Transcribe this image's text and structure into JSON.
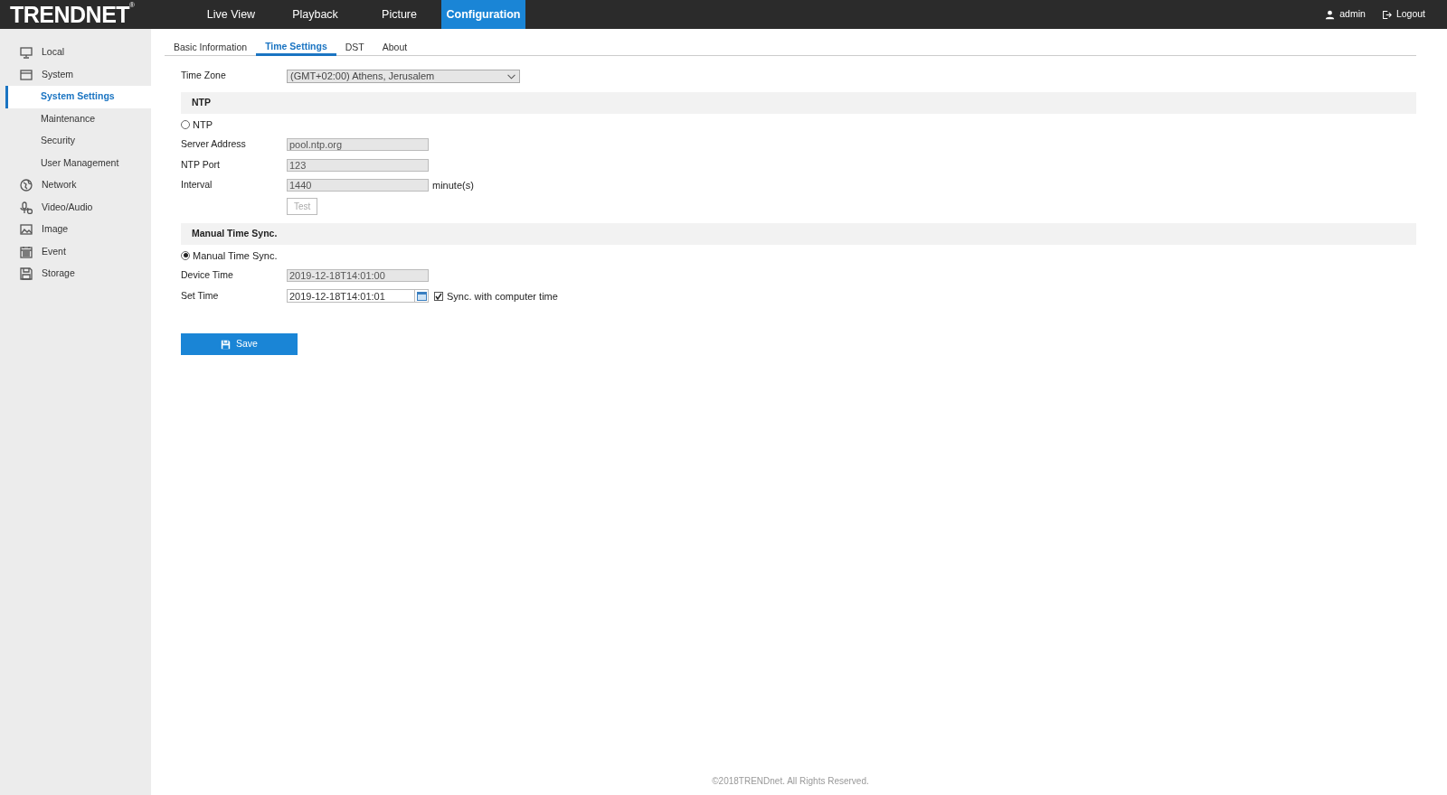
{
  "topbar": {
    "logo": "TRENDNET",
    "logo_mark": "®",
    "nav": [
      {
        "label": "Live View",
        "selected": false
      },
      {
        "label": "Playback",
        "selected": false
      },
      {
        "label": "Picture",
        "selected": false
      },
      {
        "label": "Configuration",
        "selected": true
      }
    ],
    "user": "admin",
    "logout": "Logout"
  },
  "sidebar": {
    "items": [
      {
        "label": "Local",
        "selected": false
      },
      {
        "label": "System",
        "selected": false,
        "expanded": true,
        "children": [
          {
            "label": "System Settings",
            "selected": true
          },
          {
            "label": "Maintenance",
            "selected": false
          },
          {
            "label": "Security",
            "selected": false
          },
          {
            "label": "User Management",
            "selected": false
          }
        ]
      },
      {
        "label": "Network",
        "selected": false
      },
      {
        "label": "Video/Audio",
        "selected": false
      },
      {
        "label": "Image",
        "selected": false
      },
      {
        "label": "Event",
        "selected": false
      },
      {
        "label": "Storage",
        "selected": false
      }
    ]
  },
  "tabs": [
    {
      "label": "Basic Information",
      "selected": false
    },
    {
      "label": "Time Settings",
      "selected": true
    },
    {
      "label": "DST",
      "selected": false
    },
    {
      "label": "About",
      "selected": false
    }
  ],
  "form": [
    {
      "kind": "select",
      "label": "Time Zone",
      "value": "(GMT+02:00) Athens, Jerusalem"
    },
    {
      "kind": "header",
      "label": "NTP"
    },
    {
      "kind": "radio",
      "label": "NTP",
      "checked": false
    },
    {
      "kind": "field",
      "label": "Server Address",
      "value": "pool.ntp.org",
      "disabled": true
    },
    {
      "kind": "field",
      "label": "NTP Port",
      "value": "123",
      "disabled": true
    },
    {
      "kind": "field",
      "label": "Interval",
      "value": "1440",
      "disabled": true,
      "unit": "minute(s)"
    },
    {
      "kind": "button",
      "label": "Test",
      "disabled": true
    },
    {
      "kind": "header",
      "label": "Manual Time Sync."
    },
    {
      "kind": "radio",
      "label": "Manual Time Sync.",
      "checked": true
    },
    {
      "kind": "field",
      "label": "Device Time",
      "value": "2019-12-18T14:01:00",
      "disabled": true
    },
    {
      "kind": "datetime",
      "label": "Set Time",
      "value": "2019-12-18T14:01:01",
      "disabled": false,
      "checkbox": {
        "label": "Sync. with computer time",
        "checked": true
      }
    }
  ],
  "save": "Save",
  "footer": "©2018TRENDnet. All Rights Reserved."
}
